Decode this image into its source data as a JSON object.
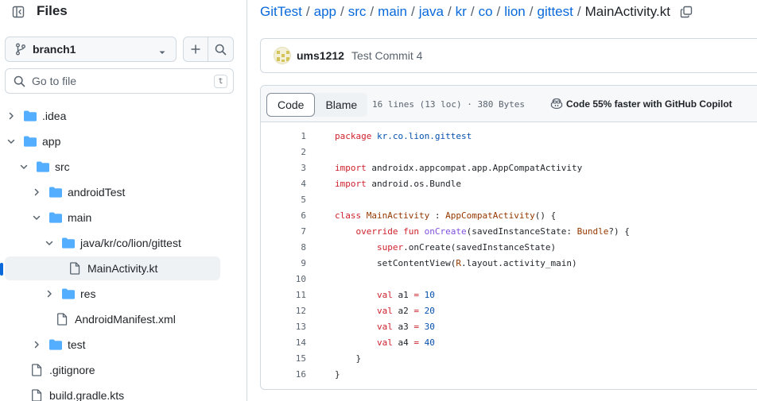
{
  "sidebar": {
    "title": "Files",
    "branch": "branch1",
    "goto_placeholder": "Go to file",
    "goto_shortcut": "t",
    "tree": [
      {
        "label": ".idea",
        "type": "folder",
        "expanded": false,
        "depth": 0
      },
      {
        "label": "app",
        "type": "folder",
        "expanded": true,
        "depth": 0
      },
      {
        "label": "src",
        "type": "folder",
        "expanded": true,
        "depth": 1
      },
      {
        "label": "androidTest",
        "type": "folder",
        "expanded": false,
        "depth": 2
      },
      {
        "label": "main",
        "type": "folder",
        "expanded": true,
        "depth": 2
      },
      {
        "label": "java/kr/co/lion/gittest",
        "type": "folder",
        "expanded": true,
        "depth": 3
      },
      {
        "label": "MainActivity.kt",
        "type": "file",
        "selected": true,
        "depth": 4
      },
      {
        "label": "res",
        "type": "folder",
        "expanded": false,
        "depth": 3
      },
      {
        "label": "AndroidManifest.xml",
        "type": "file",
        "depth": 3
      },
      {
        "label": "test",
        "type": "folder",
        "expanded": false,
        "depth": 2
      },
      {
        "label": ".gitignore",
        "type": "file",
        "depth": 1
      },
      {
        "label": "build.gradle.kts",
        "type": "file",
        "depth": 1
      }
    ]
  },
  "breadcrumb": {
    "items": [
      "GitTest",
      "app",
      "src",
      "main",
      "java",
      "kr",
      "co",
      "lion",
      "gittest"
    ],
    "current": "MainActivity.kt"
  },
  "commit": {
    "author": "ums1212",
    "message": "Test Commit 4"
  },
  "code_view": {
    "tab_code": "Code",
    "tab_blame": "Blame",
    "meta": "16 lines (13 loc) · 380 Bytes",
    "copilot": "Code 55% faster with GitHub Copilot",
    "lines": [
      {
        "n": "1",
        "tokens": [
          {
            "t": "kw",
            "v": "package "
          },
          {
            "t": "pk",
            "v": "kr.co.lion.gittest"
          }
        ]
      },
      {
        "n": "2",
        "tokens": []
      },
      {
        "n": "3",
        "tokens": [
          {
            "t": "kw",
            "v": "import "
          },
          {
            "t": "",
            "v": "androidx.appcompat.app.AppCompatActivity"
          }
        ]
      },
      {
        "n": "4",
        "tokens": [
          {
            "t": "kw",
            "v": "import "
          },
          {
            "t": "",
            "v": "android.os.Bundle"
          }
        ]
      },
      {
        "n": "5",
        "tokens": []
      },
      {
        "n": "6",
        "tokens": [
          {
            "t": "kw",
            "v": "class "
          },
          {
            "t": "ty",
            "v": "MainActivity"
          },
          {
            "t": "",
            "v": " : "
          },
          {
            "t": "ty",
            "v": "AppCompatActivity"
          },
          {
            "t": "",
            "v": "() {"
          }
        ]
      },
      {
        "n": "7",
        "tokens": [
          {
            "t": "",
            "v": "    "
          },
          {
            "t": "kw",
            "v": "override fun "
          },
          {
            "t": "fn",
            "v": "onCreate"
          },
          {
            "t": "",
            "v": "(savedInstanceState: "
          },
          {
            "t": "ty",
            "v": "Bundle"
          },
          {
            "t": "",
            "v": "?) {"
          }
        ]
      },
      {
        "n": "8",
        "tokens": [
          {
            "t": "",
            "v": "        "
          },
          {
            "t": "kw",
            "v": "super"
          },
          {
            "t": "",
            "v": ".onCreate(savedInstanceState)"
          }
        ]
      },
      {
        "n": "9",
        "tokens": [
          {
            "t": "",
            "v": "        setContentView("
          },
          {
            "t": "ty",
            "v": "R"
          },
          {
            "t": "",
            "v": ".layout.activity_main)"
          }
        ]
      },
      {
        "n": "10",
        "tokens": []
      },
      {
        "n": "11",
        "tokens": [
          {
            "t": "",
            "v": "        "
          },
          {
            "t": "kw",
            "v": "val "
          },
          {
            "t": "",
            "v": "a1 "
          },
          {
            "t": "kw",
            "v": "= "
          },
          {
            "t": "num",
            "v": "10"
          }
        ]
      },
      {
        "n": "12",
        "tokens": [
          {
            "t": "",
            "v": "        "
          },
          {
            "t": "kw",
            "v": "val "
          },
          {
            "t": "",
            "v": "a2 "
          },
          {
            "t": "kw",
            "v": "= "
          },
          {
            "t": "num",
            "v": "20"
          }
        ]
      },
      {
        "n": "13",
        "tokens": [
          {
            "t": "",
            "v": "        "
          },
          {
            "t": "kw",
            "v": "val "
          },
          {
            "t": "",
            "v": "a3 "
          },
          {
            "t": "kw",
            "v": "= "
          },
          {
            "t": "num",
            "v": "30"
          }
        ]
      },
      {
        "n": "14",
        "tokens": [
          {
            "t": "",
            "v": "        "
          },
          {
            "t": "kw",
            "v": "val "
          },
          {
            "t": "",
            "v": "a4 "
          },
          {
            "t": "kw",
            "v": "= "
          },
          {
            "t": "num",
            "v": "40"
          }
        ]
      },
      {
        "n": "15",
        "tokens": [
          {
            "t": "",
            "v": "    }"
          }
        ]
      },
      {
        "n": "16",
        "tokens": [
          {
            "t": "",
            "v": "}"
          }
        ]
      }
    ]
  },
  "colors": {
    "accent": "#0969da",
    "folder": "#54aeff",
    "keyword": "#cf222e",
    "type": "#953800",
    "function": "#8250df",
    "number": "#0550ae"
  },
  "icons": {
    "collapse_sidebar": "sidebar-collapse-icon",
    "branch": "git-branch-icon",
    "add": "plus-icon",
    "search": "search-icon",
    "folder": "folder-icon",
    "file": "file-icon",
    "copy": "copy-icon",
    "copilot": "copilot-icon"
  }
}
